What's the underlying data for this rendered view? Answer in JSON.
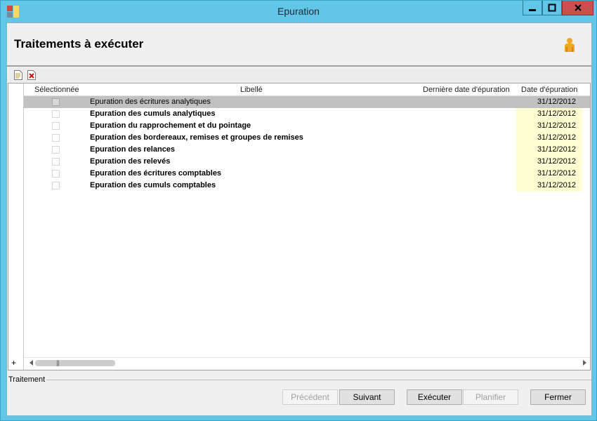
{
  "window": {
    "title": "Epuration"
  },
  "header": {
    "title": "Traitements à exécuter"
  },
  "grid": {
    "columns": {
      "selected": "Sélectionnée",
      "label": "Libellé",
      "last_date": "Dernière date d'épuration",
      "date": "Date d'épuration"
    },
    "rows": [
      {
        "label": "Epuration des écritures analytiques",
        "date": "31/12/2012"
      },
      {
        "label": "Epuration des cumuls analytiques",
        "date": "31/12/2012"
      },
      {
        "label": "Epuration du rapprochement et du pointage",
        "date": "31/12/2012"
      },
      {
        "label": "Epuration des bordereaux, remises et groupes de remises",
        "date": "31/12/2012"
      },
      {
        "label": "Epuration des relances",
        "date": "31/12/2012"
      },
      {
        "label": "Epuration des relevés",
        "date": "31/12/2012"
      },
      {
        "label": "Epuration des écritures comptables",
        "date": "31/12/2012"
      },
      {
        "label": "Epuration des cumuls comptables",
        "date": "31/12/2012"
      }
    ],
    "plus_label": "+"
  },
  "group": {
    "label": "Traitement"
  },
  "buttons": {
    "previous": "Précédent",
    "next": "Suivant",
    "execute": "Exécuter",
    "schedule": "Planifier",
    "close": "Fermer"
  },
  "colors": {
    "title_bar": "#62c6e8",
    "close_button": "#c9504f",
    "date_cell": "#fffdd2",
    "selected_row": "#c1c1c1"
  },
  "icons": {
    "app": "app-icon",
    "user": "user-icon",
    "new_document": "new-document-icon",
    "delete_document": "delete-document-icon"
  }
}
